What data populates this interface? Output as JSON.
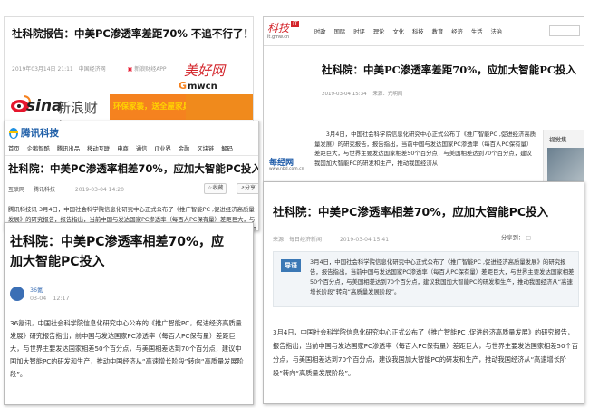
{
  "colors": {
    "accent_red": "#d3242a",
    "qq_blue": "#1f5fa8",
    "sina_red": "#e6162d",
    "meixi_orange": "#f5821f",
    "highlight_yellow": "#ffd400",
    "mrjj_blue": "#1c5aa8",
    "tag_blue": "#3b78b5"
  },
  "p1": {
    "title": "社科院报告：中美PC渗透率差距70% 不追不行了！",
    "date": "2019年03月14日 21:11",
    "source": "中国经济网",
    "app": "新浪财经APP",
    "brand_sina": "sina",
    "brand_sina_caijing": "新浪财经",
    "ad_text": "环保家装，送全屋家具",
    "icon_app": "phone-icon",
    "icon_share": "share-icon"
  },
  "p2": {
    "logo_name": "科技",
    "logo_tag": "IT",
    "logo_url": "it.gmw.cn",
    "nav": [
      "时政",
      "国际",
      "时评",
      "理论",
      "文化",
      "科技",
      "教育",
      "经济",
      "生活",
      "法治"
    ],
    "title": "社科院：中美PC渗透率差距70%，应加大智能PC投入",
    "date": "2019-03-04 15:34",
    "source": "来源：光明网",
    "para": "3月4日，中国社会科学院信息化研究中心正式公布了《推广智能PC ,促进经济高质量发展》的研究报告，报告指出，当前中国与发达国家PC渗透率（每百人PC保有量）差距巨大，与世界主要发达国家相差50个百分点，与美国相差达到70个百分点，建议我国加大智能PC的研发和生产，推动我国经济从",
    "side_caption": "视觉焦",
    "mrjj": "每经网",
    "mrjj_url": "www.nbd.com.cn"
  },
  "p3": {
    "logo": "腾讯科技",
    "nav": [
      "首页",
      "企鹅智酷",
      "腾讯出品",
      "移动互联",
      "电商",
      "通信",
      "IT业界",
      "金融",
      "区块链",
      "解码"
    ],
    "title": "社科院：中美PC渗透率相差70%，应加大智能PC投入",
    "meta_cat": "互联网",
    "meta_src": "腾讯科技",
    "date": "2019-03-04 14:20",
    "collect": "收藏",
    "share": "分享",
    "para": "腾讯科技讯 3月4日，中国社会科学院信息化研究中心正式公布了《推广智能PC ,促进经济高质量发展》的研究报告，报告指出，当前中国与发达国家PC渗透率（每百人PC保有量）差距巨大，与世界主要发达国家相差50个百分点，与美国相差达到70个百分点，建议我国加大智能PC的研发和生产，推动我国经济从“高速增长阶段”转向“高质量发展阶段”。"
  },
  "p4": {
    "title": "社科院：中美PC渗透率相差70%，应加大智能PC投入",
    "author": "36氪",
    "date": "03-04",
    "time": "12:17",
    "para": "36氪讯，中国社会科学院信息化研究中心公布的《推广智能PC，促进经济高质量发展》研究报告指出，前中国与发达国家PC渗透率（每百人PC保有量）差距巨大，与世界主要发达国家相差50个百分点，与美国相差达到70个百分点，建议中国加大智能PC的研发和生产，推动中国经济从“高速增长阶段”转向“高质量发展阶段”。"
  },
  "p5": {
    "title": "社科院：中美PC渗透率相差70%，应加大智能PC投入",
    "source": "来源：每日经济新闻",
    "date": "2019-03-04 15:41",
    "share": "分享到：",
    "tag": "导语",
    "lead": "3月4日，中国社会科学院信息化研究中心正式公布了《推广智能PC ,促进经济高质量发展》的研究报告，报告指出，当前中国与发达国家PC渗透率（每百人PC保有量）差距巨大，与世界主要发达国家相差50个百分点，与美国相差达到70个百分点，建议我国加大智能PC的研发和生产，推动我国经济从“高速增长阶段”转向“高质量发展阶段”。",
    "para": "3月4日，中国社会科学院信息化研究中心正式公布了《推广智能PC ,促进经济高质量发展》的研究报告，报告指出，当前中国与发达国家PC渗透率（每百人PC保有量）差距巨大，与世界主要发达国家相差50个百分点，与美国相差达到70个百分点，建议我国加大智能PC的研发和生产，推动我国经济从“高速增长阶段”转向“高质量发展阶段”。"
  }
}
